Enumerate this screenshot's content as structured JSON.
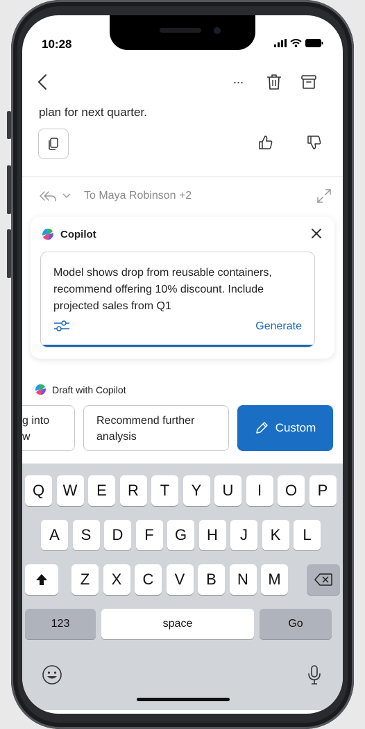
{
  "status_bar": {
    "time": "10:28"
  },
  "toolbar": {
    "back_icon": "chevron-left-icon",
    "more_label": "···",
    "delete_icon": "trash-icon",
    "archive_icon": "archive-icon"
  },
  "message": {
    "text": "plan for next quarter."
  },
  "reply": {
    "to_label": "To Maya Robinson +2"
  },
  "copilot": {
    "title": "Copilot",
    "prompt": "Model shows drop from reusable containers, recommend offering 10% discount. Include projected sales from Q1",
    "generate_label": "Generate"
  },
  "draft": {
    "title": "Draft with Copilot",
    "chip_partial_line1": "g into",
    "chip_partial_line2": "w",
    "chip_analysis": "Recommend further analysis",
    "chip_custom": "Custom"
  },
  "keyboard": {
    "row1": [
      "Q",
      "W",
      "E",
      "R",
      "T",
      "Y",
      "U",
      "I",
      "O",
      "P"
    ],
    "row2": [
      "A",
      "S",
      "D",
      "F",
      "G",
      "H",
      "J",
      "K",
      "L"
    ],
    "row3": [
      "Z",
      "X",
      "C",
      "V",
      "B",
      "N",
      "M"
    ],
    "numbers_key": "123",
    "space_key": "space",
    "go_key": "Go"
  },
  "colors": {
    "accent": "#1a6fc4",
    "keyboard_bg": "#d1d4d9"
  }
}
